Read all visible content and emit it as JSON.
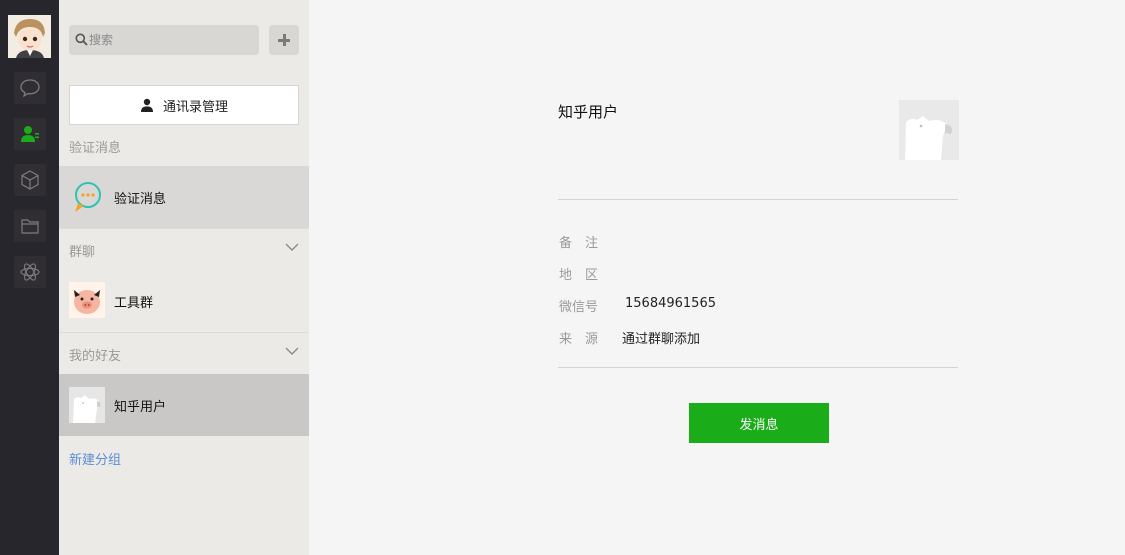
{
  "search": {
    "placeholder": "搜索"
  },
  "contacts_panel": {
    "manage_label": "通讯录管理",
    "sections": {
      "verify": {
        "label": "验证消息",
        "item_name": "验证消息"
      },
      "groups": {
        "label": "群聊",
        "item_name": "工具群"
      },
      "friends": {
        "label": "我的好友",
        "item_name": "知乎用户"
      }
    },
    "new_group_label": "新建分组"
  },
  "profile": {
    "name": "知乎用户",
    "fields": [
      {
        "label": "备　注",
        "value": ""
      },
      {
        "label": "地　区",
        "value": ""
      },
      {
        "label": "微信号",
        "value": "15684961565"
      },
      {
        "label": "来　源",
        "value": "通过群聊添加"
      }
    ],
    "send_label": "发消息"
  },
  "colors": {
    "rail_bg": "#28262d",
    "panel_bg": "#eceae6",
    "selected_row": "#c9c8c7",
    "hover_row": "#d9d8d6",
    "accent_green": "#1aad19",
    "link_blue": "#5b8ed6"
  },
  "icons": {
    "rail": [
      "chat-icon",
      "contacts-icon",
      "box-icon",
      "folder-icon",
      "atom-icon"
    ],
    "panel": [
      "search-icon",
      "plus-icon",
      "person-icon",
      "chevron-down-icon"
    ]
  }
}
